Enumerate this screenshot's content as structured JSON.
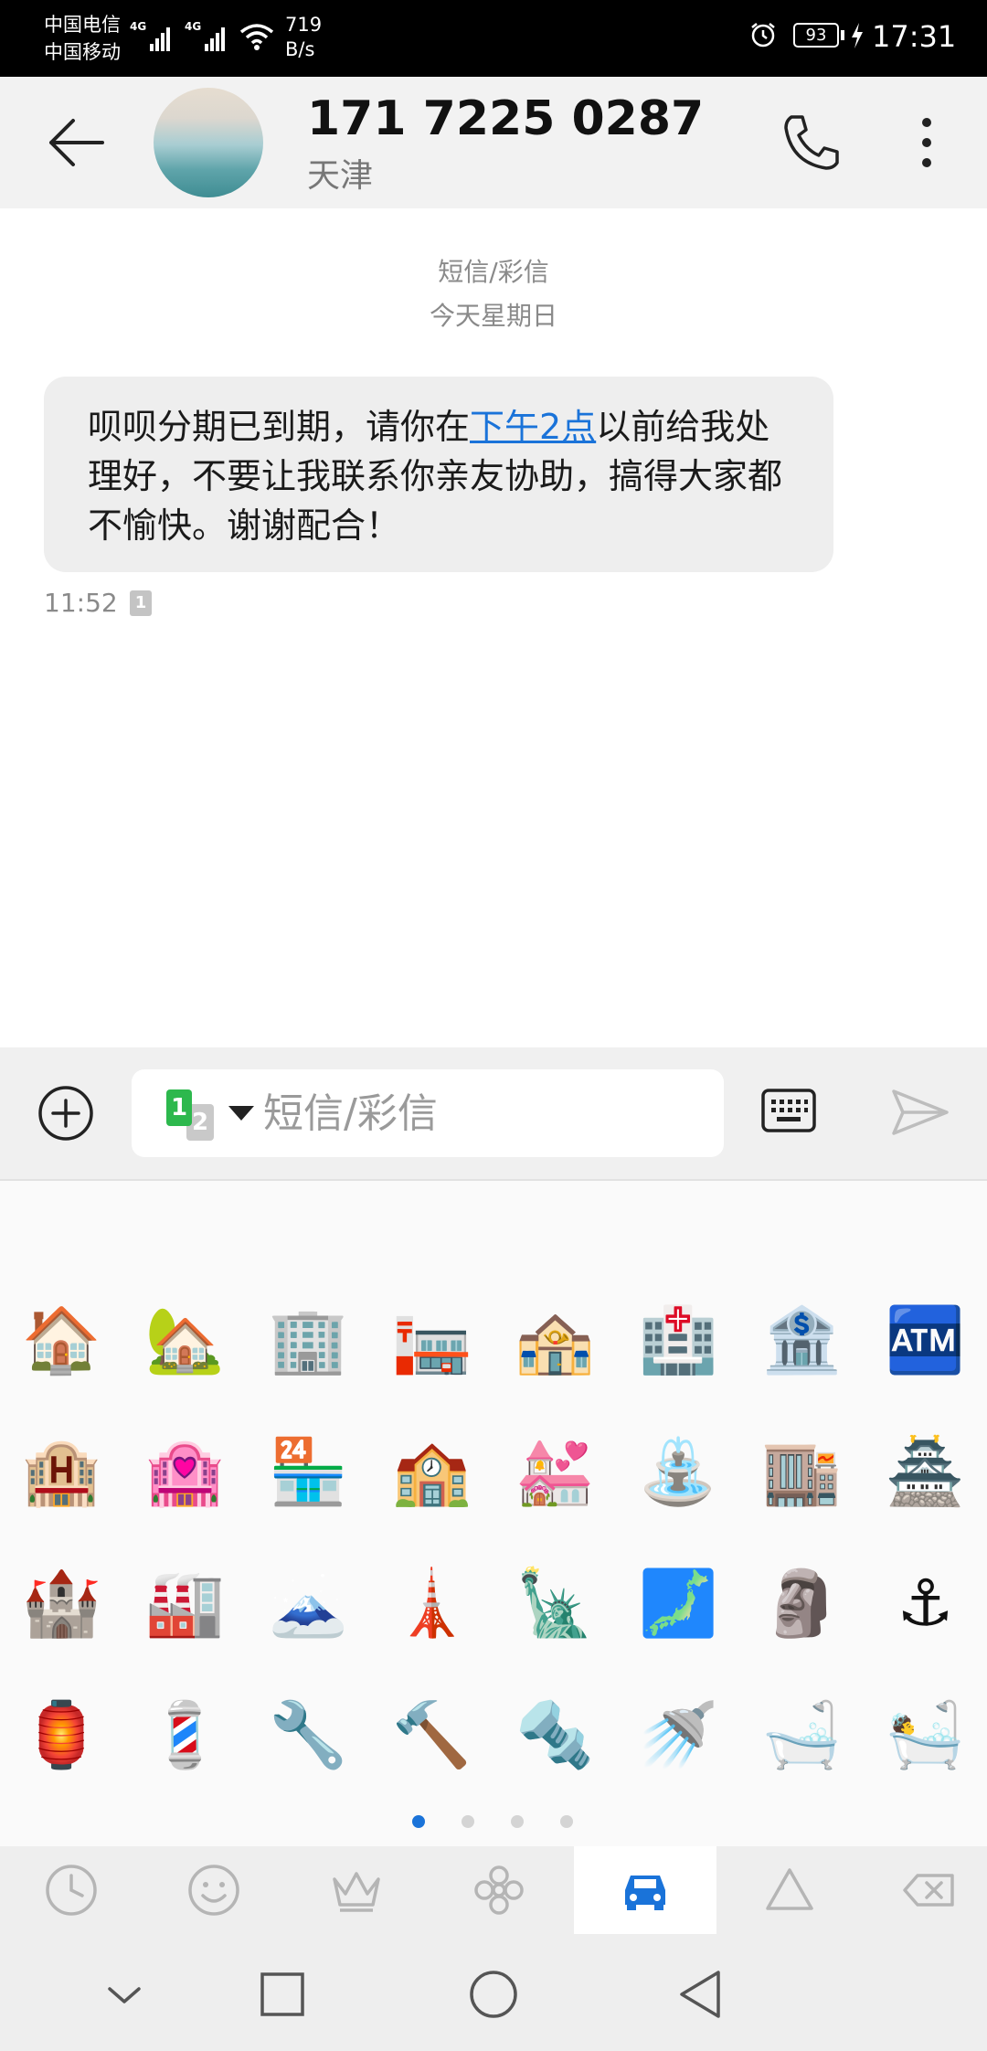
{
  "status_bar": {
    "carrier1": "中国电信",
    "carrier2": "中国移动",
    "net1": "4G",
    "net2": "4G",
    "speed_value": "719",
    "speed_unit": "B/s",
    "battery": "93",
    "time": "17:31"
  },
  "header": {
    "contact_number": "171 7225 0287",
    "location": "天津"
  },
  "conversation": {
    "message_type": "短信/彩信",
    "date": "今天星期日",
    "message": {
      "text_before": "呗呗分期已到期，请你在",
      "link": "下午2点",
      "text_after": "以前给我处理好，不要让我联系你亲友协助，搞得大家都不愉快。谢谢配合！",
      "time": "11:52",
      "sim": "1"
    }
  },
  "compose": {
    "sim1": "1",
    "sim2": "2",
    "placeholder": "短信/彩信"
  },
  "emoji_grid": {
    "rows": [
      [
        "🏠",
        "🏡",
        "🏢",
        "🏣",
        "🏤",
        "🏥",
        "🏦",
        "🏧"
      ],
      [
        "🏨",
        "🏩",
        "🏪",
        "🏫",
        "💒",
        "⛲",
        "🏬",
        "🏯"
      ],
      [
        "🏰",
        "🏭",
        "🗻",
        "🗼",
        "🗽",
        "🗾",
        "🗿",
        "⚓"
      ],
      [
        "🏮",
        "💈",
        "🔧",
        "🔨",
        "🔩",
        "🚿",
        "🛁",
        "🛀"
      ]
    ],
    "page_count": 4,
    "active_page": 1
  },
  "categories": [
    "recent-icon",
    "smiley-icon",
    "crown-icon",
    "flower-icon",
    "car-icon",
    "triangle-icon",
    "backspace-icon"
  ],
  "colors": {
    "accent": "#1a73d9",
    "sim1": "#2db84d",
    "header_bg": "#f2f2f2",
    "bubble_bg": "#eeeeee"
  }
}
